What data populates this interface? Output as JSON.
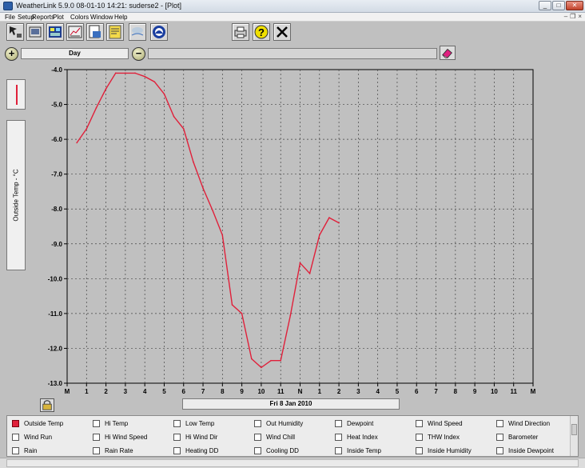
{
  "window": {
    "title": "WeatherLink 5.9.0  08-01-10  14:21: suderse2 - [Plot]"
  },
  "menu": [
    "File",
    "Setup",
    "Reports",
    "Plot",
    "Colors",
    "Window",
    "Help"
  ],
  "toolbar": {
    "left_tools": [
      "select-icon",
      "station-icon",
      "bulletin-icon",
      "bar-chart-icon",
      "summary-icon",
      "notes-icon",
      "wind-icon",
      "noaa-icon"
    ],
    "right_tools": [
      "print-icon",
      "help-icon",
      "close-icon"
    ]
  },
  "range": {
    "zoom_in": "+",
    "zoom_out": "−",
    "period": "Day"
  },
  "plot": {
    "y_axis_label": "Outside Temp - °C",
    "date_label": "Fri 8 Jan 2010",
    "line_color": "#e0203a"
  },
  "chart_data": {
    "type": "line",
    "ylim": [
      -13.0,
      -4.0
    ],
    "y_ticks": [
      "-4.0",
      "-5.0",
      "-6.0",
      "-7.0",
      "-8.0",
      "-9.0",
      "-10.0",
      "-11.0",
      "-12.0",
      "-13.0"
    ],
    "x_tick_labels": [
      "M",
      "1",
      "2",
      "3",
      "4",
      "5",
      "6",
      "7",
      "8",
      "9",
      "10",
      "11",
      "N",
      "1",
      "2",
      "3",
      "4",
      "5",
      "6",
      "7",
      "8",
      "9",
      "10",
      "11",
      "M"
    ],
    "grid": true,
    "series": [
      {
        "x": [
          0.5,
          1.0,
          1.5,
          2.0,
          2.5,
          3.0,
          3.5,
          4.0,
          4.5,
          5.0,
          5.5,
          6.0,
          6.5,
          7.0,
          7.5,
          8.0,
          8.5,
          9.0,
          9.5,
          10.0,
          10.5,
          11.0,
          11.5,
          12.0,
          12.5,
          13.0,
          13.5,
          14.0
        ],
        "y": [
          -6.1,
          -5.7,
          -5.1,
          -4.55,
          -4.1,
          -4.1,
          -4.1,
          -4.2,
          -4.35,
          -4.7,
          -5.35,
          -5.7,
          -6.65,
          -7.4,
          -8.05,
          -8.75,
          -10.75,
          -11.0,
          -12.3,
          -12.55,
          -12.35,
          -12.35,
          -11.05,
          -9.55,
          -9.85,
          -8.75,
          -8.25,
          -8.4
        ]
      }
    ]
  },
  "params": [
    [
      {
        "label": "Outside Temp",
        "checked": true
      },
      {
        "label": "Hi Temp"
      },
      {
        "label": "Low Temp"
      },
      {
        "label": "Out Humidity"
      },
      {
        "label": "Dewpoint"
      },
      {
        "label": "Wind Speed"
      },
      {
        "label": "Wind Direction"
      }
    ],
    [
      {
        "label": "Wind Run"
      },
      {
        "label": "Hi Wind Speed"
      },
      {
        "label": "Hi Wind Dir"
      },
      {
        "label": "Wind Chill"
      },
      {
        "label": "Heat Index"
      },
      {
        "label": "THW Index"
      },
      {
        "label": "Barometer"
      }
    ],
    [
      {
        "label": "Rain"
      },
      {
        "label": "Rain Rate"
      },
      {
        "label": "Heating DD"
      },
      {
        "label": "Cooling DD"
      },
      {
        "label": "Inside Temp"
      },
      {
        "label": "Inside Humidity"
      },
      {
        "label": "Inside Dewpoint"
      }
    ]
  ]
}
